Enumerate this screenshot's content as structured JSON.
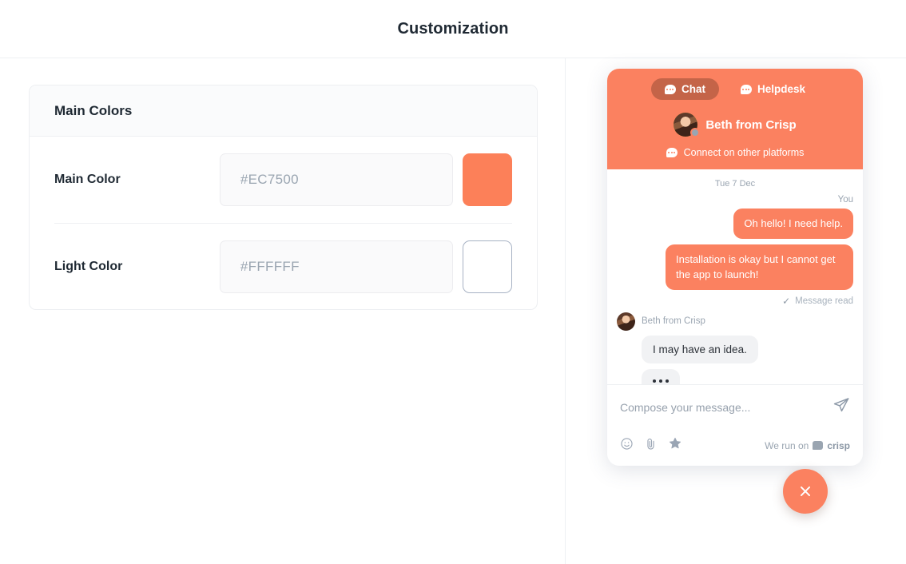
{
  "window": {
    "title": "Customization"
  },
  "settings": {
    "card_title": "Main Colors",
    "rows": [
      {
        "label": "Main Color",
        "value": "#EC7500",
        "swatch_color": "#FC8059"
      },
      {
        "label": "Light Color",
        "value": "#FFFFFF",
        "swatch_color": "#FFFFFF"
      }
    ]
  },
  "widget": {
    "tabs": [
      {
        "label": "Chat",
        "active": true
      },
      {
        "label": "Helpdesk",
        "active": false
      }
    ],
    "agent_name": "Beth from Crisp",
    "connect_label": "Connect on other platforms",
    "header_color": "#FB8160",
    "conversation": {
      "date_separator": "Tue 7 Dec",
      "you_label": "You",
      "outgoing": [
        "Oh hello! I need help.",
        "Installation is okay but I cannot get the app to launch!"
      ],
      "read_status": "Message read",
      "incoming_author": "Beth from Crisp",
      "incoming": [
        "I may have an idea."
      ]
    },
    "composer": {
      "placeholder": "Compose your message...",
      "brand_prefix": "We run on",
      "brand_name": "crisp"
    }
  }
}
